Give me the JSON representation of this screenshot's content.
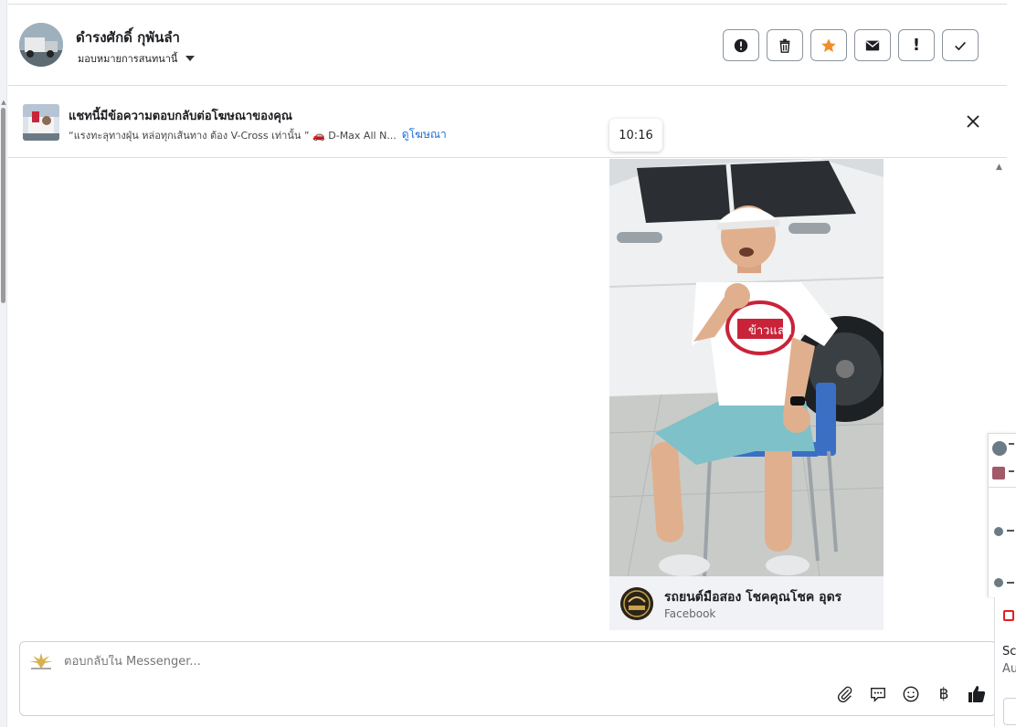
{
  "header": {
    "contact_name": "ดำรงศักดิ์ กุพันลำ",
    "assign_label": "มอบหมายการสนทนานี้"
  },
  "actions": [
    {
      "name": "spam-button",
      "icon": "alert-circle-icon"
    },
    {
      "name": "delete-button",
      "icon": "trash-icon"
    },
    {
      "name": "star-button",
      "icon": "star-icon",
      "color": "#f28c28"
    },
    {
      "name": "mark-unread-button",
      "icon": "envelope-icon"
    },
    {
      "name": "follow-up-button",
      "icon": "exclamation-icon",
      "label": "!"
    },
    {
      "name": "mark-done-button",
      "icon": "check-icon"
    }
  ],
  "ad_banner": {
    "title": "แชทนี้มีข้อความตอบกลับต่อโฆษณาของคุณ",
    "subtitle": "“แรงทะลุทางฝุ่น หล่อทุกเส้นทาง ต้อง V-Cross เท่านั้น ” 🚗 D-Max All N...",
    "link": "ดูโฆษณา"
  },
  "timestamp_tooltip": "10:16",
  "media_card": {
    "page_name": "รถยนต์มือสอง โชคคุณโชค อุดร",
    "source": "Facebook",
    "shirt_text": "ข้าวแลก"
  },
  "composer": {
    "placeholder": "ตอบกลับใน Messenger...",
    "tools": [
      "paperclip-icon",
      "saved-reply-icon",
      "emoji-icon",
      "baht-icon",
      "thumbs-up-icon"
    ],
    "baht_symbol": "฿"
  },
  "side_peek": {
    "text1": "Sc",
    "text2": "Au"
  },
  "colors": {
    "accent_link": "#216fdb",
    "star": "#f28c28",
    "border": "#dadde1"
  }
}
